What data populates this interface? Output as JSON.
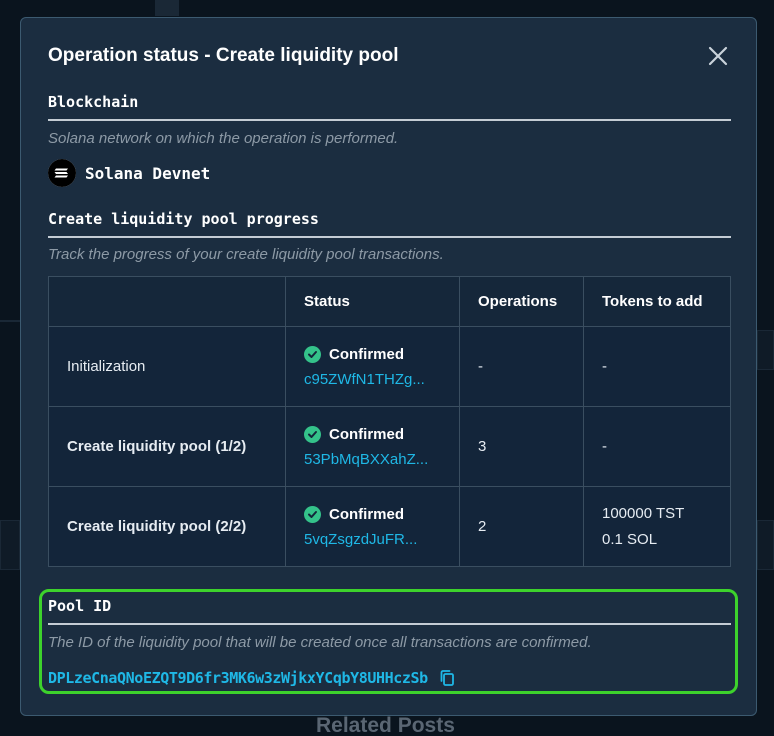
{
  "modal": {
    "title": "Operation status - Create liquidity pool",
    "close_icon": "close-icon"
  },
  "blockchain": {
    "heading": "Blockchain",
    "description": "Solana network on which the operation is performed.",
    "network_name": "Solana Devnet",
    "logo_icon": "solana-logo-icon"
  },
  "progress": {
    "heading": "Create liquidity pool progress",
    "description": "Track the progress of your create liquidity pool transactions.",
    "columns": [
      "",
      "Status",
      "Operations",
      "Tokens to add"
    ],
    "rows": [
      {
        "name": "Initialization",
        "status": "Confirmed",
        "tx": "c95ZWfN1THZg...",
        "operations": "-",
        "tokens": [
          "-"
        ]
      },
      {
        "name": "Create liquidity pool (1/2)",
        "status": "Confirmed",
        "tx": "53PbMqBXXahZ...",
        "operations": "3",
        "tokens": [
          "-"
        ]
      },
      {
        "name": "Create liquidity pool (2/2)",
        "status": "Confirmed",
        "tx": "5vqZsgzdJuFR...",
        "operations": "2",
        "tokens": [
          "100000 TST",
          "0.1 SOL"
        ]
      }
    ]
  },
  "pool": {
    "heading": "Pool ID",
    "description": "The ID of the liquidity pool that will be created once all transactions are confirmed.",
    "id": "DPLzeCnaQNoEZQT9D6fr3MK6w3zWjkxYCqbY8UHHczSb",
    "copy_icon": "copy-icon"
  },
  "background": {
    "related_posts": "Related Posts"
  },
  "colors": {
    "modal_bg": "#1b2d40",
    "accent_link": "#1fb8e6",
    "confirmed_green": "#34c28a",
    "highlight_border": "#3dd22c"
  }
}
